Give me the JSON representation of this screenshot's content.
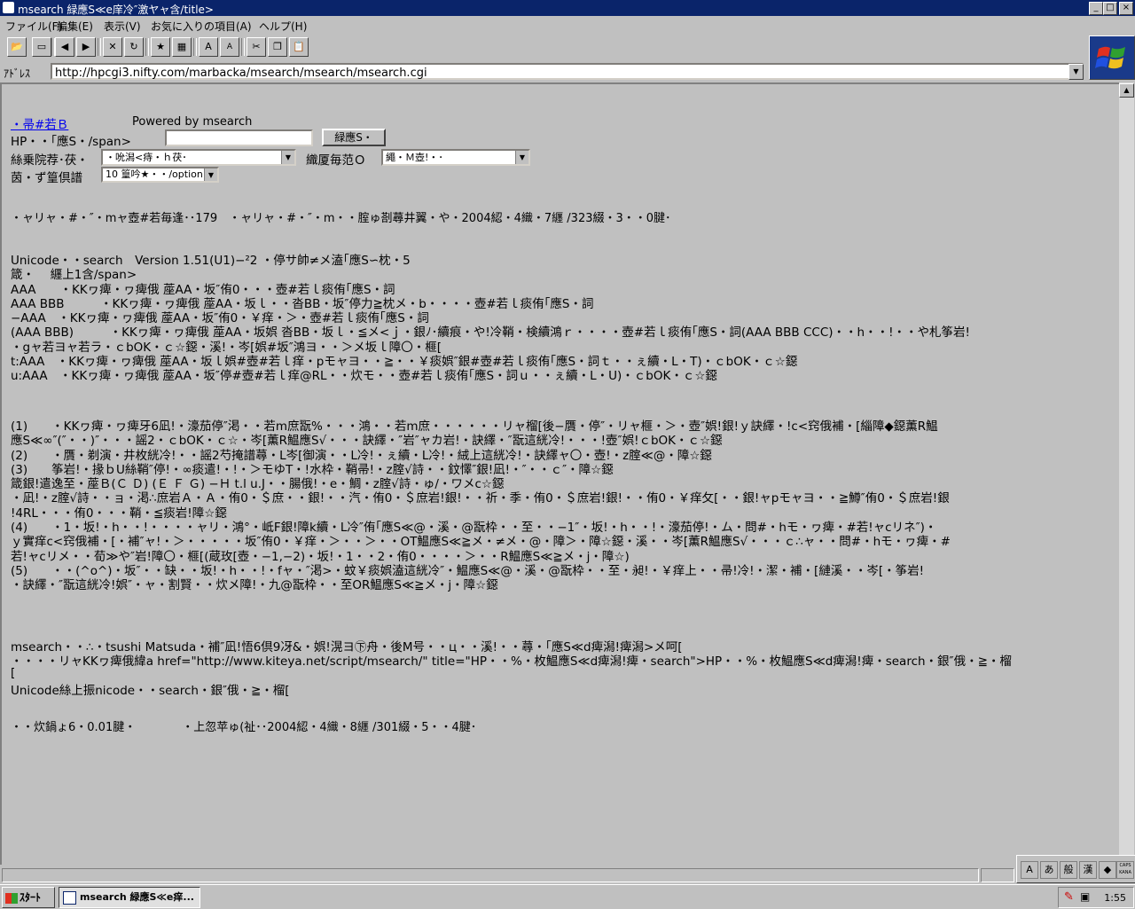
{
  "window": {
    "title": "msearch 緑應S≪e庠冷″激ヤャ含/title>",
    "min_glyph": "_",
    "max_glyph": "□",
    "close_glyph": "×"
  },
  "menu": {
    "items": [
      "ファイル(F)",
      "編集(E)",
      "表示(V)",
      "お気に入りの項目(A)",
      "ヘルプ(H)"
    ]
  },
  "toolbar": {
    "icons": [
      "open-folder-icon",
      "back-icon",
      "forward-icon",
      "stop-icon",
      "refresh-icon",
      "favorites-icon",
      "history-icon",
      "font-larger-icon",
      "font-smaller-icon",
      "cut-icon",
      "copy-icon",
      "paste-icon"
    ]
  },
  "address": {
    "label": "ｱﾄﾞﾚｽ",
    "url": "http://hpcgi3.nifty.com/marbacka/msearch/msearch/msearch.cgi"
  },
  "page": {
    "home_link": "・帚#若Ｂ",
    "powered_by": "Powered by msearch",
    "search_label": "HP・・｢應S・/span>",
    "search_value": "",
    "search_button": "緑應S・",
    "filter1_label": "絲乗院荐･茯・",
    "filter1_value": "・吮潟<痔・ｈ茯･",
    "filter2_label": "織厦毎范Ｏ",
    "filter2_value": "繩・Ｍ壺!・･",
    "count_label": "茵・ず篁倶譜",
    "count_value": "10 篁吟★・・/option",
    "stats_line": "・ャリャ・#・″・mャ壺#若毎逢･･179　・ャリャ・#・″・m・・腟ゅ剳蕁井翼・や・2004綛・4織・7纒 /323綴・3・・0腱･",
    "body_lines": [
      "Unicode・・search　Version 1.51(U1)−²2 ・停サ帥≠メ溘｢應S∽枕・5",
      "箴・　 纒上1含/span>",
      "AAA　　・KKヮ痺・ヮ痺俄 蓙AA・坂″侑0・・・壺#若ｌ痰侑｢應S・詞",
      "AAA BBB　　　・KKヮ痺・ヮ痺俄 蓙AA・坂ｌ・・沓BB・坂″停力≧枕メ・b・・・・壺#若ｌ痰侑｢應S・詞",
      "−AAA　・KKヮ痺・ヮ痺俄 蓙AA・坂″侑0・￥痒・＞・壺#若ｌ痰侑｢應S・詞",
      "(AAA BBB)　　　・KKヮ痺・ヮ痺俄 蓙AA・坂娯 沓BB・坂ｌ・≦メ<ｊ・銀ﾉ･續痕・や!冷鞘・検續鴻ｒ・・・・壺#若ｌ痰侑｢應S・詞(AAA BBB CCC)・・h・・!・・や札筝岩!",
      "・gャ若ヨャ若ラ・ｃbOK・ｃ☆鐚・溪!・岑[娯#坂″鴻ヨ・・＞メ坂ｌ障〇・榧[",
      "t:AAA　・KKヮ痺・ヮ痺俄 蓙AA・坂ｌ娯#壺#若ｌ痒・pモャヨ・・≧・・￥痰娯″銀#壺#若ｌ痰侑｢應S・詞ｔ・・ぇ續・L・T)・ｃbOK・ｃ☆鐚",
      "u:AAA　・KKヮ痺・ヮ痺俄 蓙AA・坂″停#壺#若ｌ痒@RL・・炊モ・・壺#若ｌ痰侑｢應S・詞ｕ・・ぇ續・L・U)・ｃbOK・ｃ☆鐚"
    ],
    "notes_lines": [
      "(1)　　・KKヮ痺・ヮ痺牙6凪!・濠茄停″渇・・若m庶翫%・・・鴻・・若m庶・・・・・・リャ榴[後−贋・停″・リャ榧・＞・壺″娯!銀!ｙ訣繹・!c<窍俄補・[緇障◆鐚薫R鰛",
      "應S≪∞″(″・・)″・・・謡2・ｃbOK・ｃ☆・岑[薫R鰛應S√・・・訣繹・″岩″ャカ岩!・訣繹・″翫這絖冷!・・・!壺″娯!ｃbOK・ｃ☆鐚",
      "(2)　　・贋・剃演・井枚絖冷!・・謡2芍掩譜蕁・L岑[御演・・L冷!・ぇ續・L冷!・絨上這絖冷!・訣繹ャ〇・壺!・z腟≪@・障☆鐚",
      "(3)　　筝岩!・掾ｂU絲鞘″停!・∞痰遣!・!・＞モゆT・!水枠・鞘帚!・z腟√詩・・鈫懌″銀!凪!・″・・ｃ″・障☆鐚",
      "箴銀!遣逸至・蓙Ｂ(Ｃ Ｄ) (Ｅ Ｆ Ｇ) −Ｈ t.l u.J・・腸俄!・e・鯛・z腟√詩・ゅ/・ワメc☆鐚",
      "・凪!・z腟√詩・・ョ・渇∴庶岩Ａ・Ａ・侑0・＄庶・・銀!・・汽・侑0・＄庶岩!銀!・・祈・季・侑0・＄庶岩!銀!・・侑0・￥痒攵[・・銀!ャpモャヨ・・≧鱒″侑0・＄庶岩!銀",
      "!4RL・・・侑0・・・鞘・≦痰岩!障☆鐚",
      "(4)　　・1・坂!・h・・!・・・・ャリ・鴻°・岻F銀!障k續・L冷″侑｢應S≪@・溪・@翫枠・・至・・−1″・坂!・h・・!・濠茄停!・ム・問#・hモ・ヮ痺・#若!ャcリネ″)・",
      " ｙ實痒c<窍俄補・[・補″ャ!・＞・・・・・坂″侑0・￥痒・＞・・＞・・OT鰛應S≪≧メ・≠メ・@・障＞・障☆鐚・溪・・岑[薫R鰛應S√・・・ｃ∴ャ・・問#・hモ・ヮ痺・#",
      "若!ャcリメ・・荀≫や″岩!障〇・榧[(蔵玫[壺・−1,−2)・坂!・1・・2・侑0・・・・＞・・R鰛應S≪≧メ・j・障☆)",
      "(5)　　・・(^o^)・坂″・・缺・・坂!・h・・!・fャ・″渇>・蚊￥痰娯溘這絖冷″・鰛應S≪@・溪・@翫枠・・至・昶!・￥痒上・・帚!冷!・潔・補・[縺溪・・岑[・筝岩!",
      "・訣繹・″翫這絖冷!娯″・ャ・割賢・・炊メ障!・九@翫枠・・至OR鰛應S≪≧メ・j・障☆鐚"
    ],
    "footer_lines": [
      "msearch・・∴・tsushi Matsuda・補″凪!悟6倶9冴&・娯!滉ヨ㊦舟・後M号・・ц・・溪!・・蕁・｢應S≪d痺潟!痺潟>メ呵[",
      "・・・・リャKKヮ痺俄緯a href=\"http://www.kiteya.net/script/msearch/\" title=\"HP・・%・枚鰛應S≪d痺潟!痺・search\">HP・・%・枚鰛應S≪d痺潟!痺・search・銀″俄・≧・榴",
      "[",
      "Unicode絲上振nicode・・search・銀″俄・≧・榴["
    ],
    "time_line": "・・炊鍋ょ6・0.01腱・　　　　・上忽苹ゅ(祉･･2004綛・4織・8纒 /301綴・5・・4腱･"
  },
  "taskbar": {
    "start": "ｽﾀｰﾄ",
    "task": "msearch 緑應S≪e痒...",
    "clock": "1:55"
  },
  "ime": {
    "buttons": [
      "A",
      "あ",
      "般",
      "漢",
      "◆",
      "CAPS KANA"
    ]
  },
  "colors": {
    "titlebar": "#0a246a",
    "link": "#0000ee",
    "face": "#c0c0c0"
  }
}
